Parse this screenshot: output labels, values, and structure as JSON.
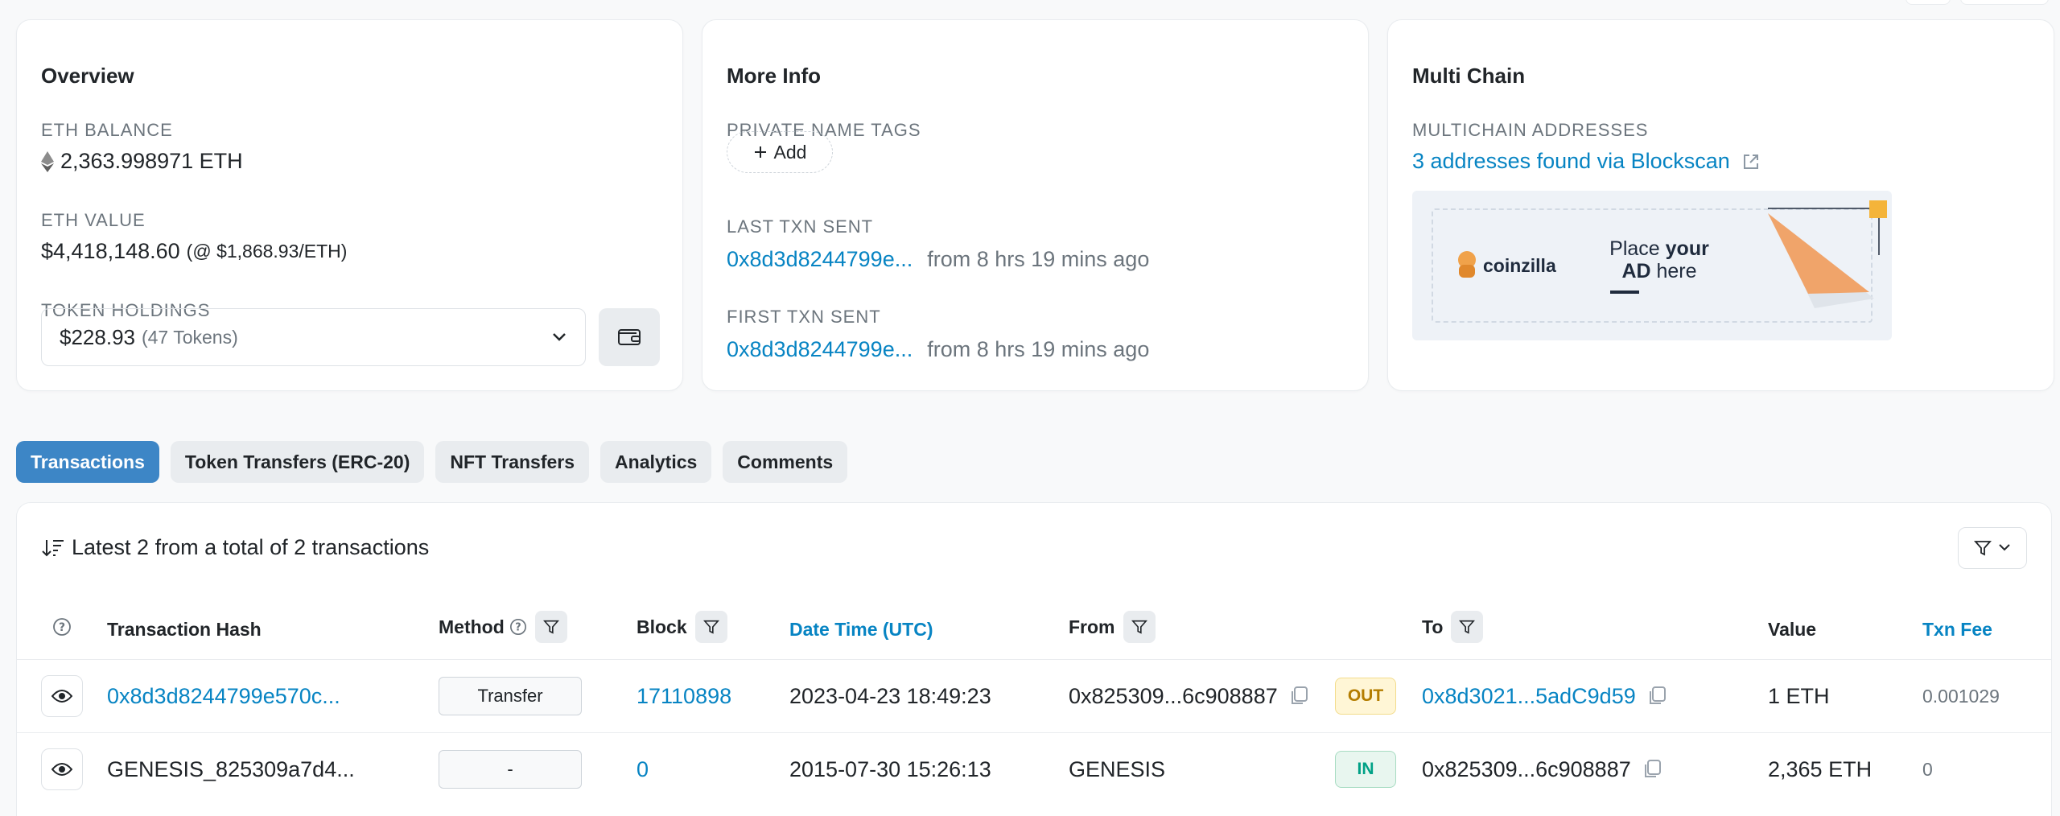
{
  "overview": {
    "title": "Overview",
    "eth_balance_label": "ETH BALANCE",
    "eth_balance": "2,363.998971 ETH",
    "eth_value_label": "ETH VALUE",
    "eth_value": "$4,418,148.60",
    "eth_price": "(@ $1,868.93/ETH)",
    "token_holdings_label": "TOKEN HOLDINGS",
    "token_value": "$228.93",
    "token_count": "(47 Tokens)"
  },
  "more_info": {
    "title": "More Info",
    "tags_label": "PRIVATE NAME TAGS",
    "add_label": "Add",
    "last_txn_label": "LAST TXN SENT",
    "last_txn_hash": "0x8d3d8244799e...",
    "last_txn_time": "from 8 hrs 19 mins ago",
    "first_txn_label": "FIRST TXN SENT",
    "first_txn_hash": "0x8d3d8244799e...",
    "first_txn_time": "from 8 hrs 19 mins ago"
  },
  "multi_chain": {
    "title": "Multi Chain",
    "addresses_label": "MULTICHAIN ADDRESSES",
    "addresses_link": "3 addresses found via Blockscan",
    "ad_brand": "coinzilla",
    "ad_text_1": "Place",
    "ad_text_2": "your",
    "ad_text_3": "AD",
    "ad_text_4": "here"
  },
  "tabs": [
    {
      "label": "Transactions",
      "active": true
    },
    {
      "label": "Token Transfers (ERC-20)",
      "active": false
    },
    {
      "label": "NFT Transfers",
      "active": false
    },
    {
      "label": "Analytics",
      "active": false
    },
    {
      "label": "Comments",
      "active": false
    }
  ],
  "table": {
    "summary": "Latest 2 from a total of 2 transactions",
    "headers": {
      "hash": "Transaction Hash",
      "method": "Method",
      "block": "Block",
      "datetime": "Date Time (UTC)",
      "from": "From",
      "to": "To",
      "value": "Value",
      "fee": "Txn Fee"
    },
    "rows": [
      {
        "hash": "0x8d3d8244799e570c...",
        "method": "Transfer",
        "block": "17110898",
        "datetime": "2023-04-23 18:49:23",
        "from": "0x825309...6c908887",
        "direction": "OUT",
        "to": "0x8d3021...5adC9d59",
        "value": "1 ETH",
        "fee": "0.001029"
      },
      {
        "hash": "GENESIS_825309a7d4...",
        "method": "-",
        "block": "0",
        "datetime": "2015-07-30 15:26:13",
        "from": "GENESIS",
        "direction": "IN",
        "to": "0x825309...6c908887",
        "value": "2,365 ETH",
        "fee": "0"
      }
    ]
  },
  "colors": {
    "link": "#0784c3",
    "tab_active": "#3d86c6",
    "out_badge": "#b47d00",
    "in_badge": "#00a186"
  }
}
